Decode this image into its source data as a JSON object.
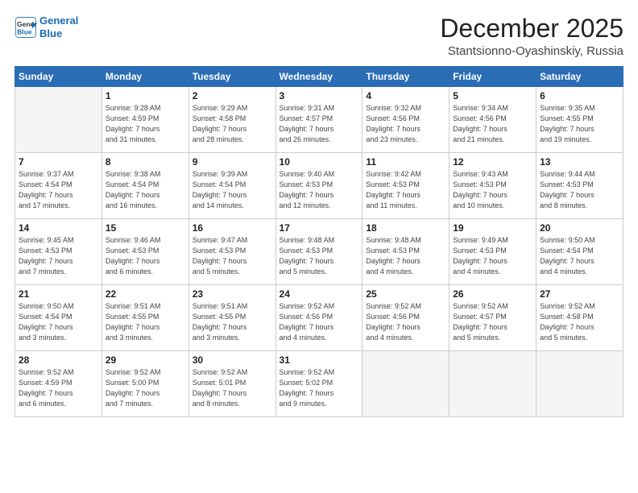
{
  "header": {
    "logo_line1": "General",
    "logo_line2": "Blue",
    "month": "December 2025",
    "location": "Stantsionno-Oyashinskiy, Russia"
  },
  "days_of_week": [
    "Sunday",
    "Monday",
    "Tuesday",
    "Wednesday",
    "Thursday",
    "Friday",
    "Saturday"
  ],
  "weeks": [
    [
      {
        "day": "",
        "info": ""
      },
      {
        "day": "1",
        "info": "Sunrise: 9:28 AM\nSunset: 4:59 PM\nDaylight: 7 hours\nand 31 minutes."
      },
      {
        "day": "2",
        "info": "Sunrise: 9:29 AM\nSunset: 4:58 PM\nDaylight: 7 hours\nand 28 minutes."
      },
      {
        "day": "3",
        "info": "Sunrise: 9:31 AM\nSunset: 4:57 PM\nDaylight: 7 hours\nand 26 minutes."
      },
      {
        "day": "4",
        "info": "Sunrise: 9:32 AM\nSunset: 4:56 PM\nDaylight: 7 hours\nand 23 minutes."
      },
      {
        "day": "5",
        "info": "Sunrise: 9:34 AM\nSunset: 4:56 PM\nDaylight: 7 hours\nand 21 minutes."
      },
      {
        "day": "6",
        "info": "Sunrise: 9:35 AM\nSunset: 4:55 PM\nDaylight: 7 hours\nand 19 minutes."
      }
    ],
    [
      {
        "day": "7",
        "info": "Sunrise: 9:37 AM\nSunset: 4:54 PM\nDaylight: 7 hours\nand 17 minutes."
      },
      {
        "day": "8",
        "info": "Sunrise: 9:38 AM\nSunset: 4:54 PM\nDaylight: 7 hours\nand 16 minutes."
      },
      {
        "day": "9",
        "info": "Sunrise: 9:39 AM\nSunset: 4:54 PM\nDaylight: 7 hours\nand 14 minutes."
      },
      {
        "day": "10",
        "info": "Sunrise: 9:40 AM\nSunset: 4:53 PM\nDaylight: 7 hours\nand 12 minutes."
      },
      {
        "day": "11",
        "info": "Sunrise: 9:42 AM\nSunset: 4:53 PM\nDaylight: 7 hours\nand 11 minutes."
      },
      {
        "day": "12",
        "info": "Sunrise: 9:43 AM\nSunset: 4:53 PM\nDaylight: 7 hours\nand 10 minutes."
      },
      {
        "day": "13",
        "info": "Sunrise: 9:44 AM\nSunset: 4:53 PM\nDaylight: 7 hours\nand 8 minutes."
      }
    ],
    [
      {
        "day": "14",
        "info": "Sunrise: 9:45 AM\nSunset: 4:53 PM\nDaylight: 7 hours\nand 7 minutes."
      },
      {
        "day": "15",
        "info": "Sunrise: 9:46 AM\nSunset: 4:53 PM\nDaylight: 7 hours\nand 6 minutes."
      },
      {
        "day": "16",
        "info": "Sunrise: 9:47 AM\nSunset: 4:53 PM\nDaylight: 7 hours\nand 5 minutes."
      },
      {
        "day": "17",
        "info": "Sunrise: 9:48 AM\nSunset: 4:53 PM\nDaylight: 7 hours\nand 5 minutes."
      },
      {
        "day": "18",
        "info": "Sunrise: 9:48 AM\nSunset: 4:53 PM\nDaylight: 7 hours\nand 4 minutes."
      },
      {
        "day": "19",
        "info": "Sunrise: 9:49 AM\nSunset: 4:53 PM\nDaylight: 7 hours\nand 4 minutes."
      },
      {
        "day": "20",
        "info": "Sunrise: 9:50 AM\nSunset: 4:54 PM\nDaylight: 7 hours\nand 4 minutes."
      }
    ],
    [
      {
        "day": "21",
        "info": "Sunrise: 9:50 AM\nSunset: 4:54 PM\nDaylight: 7 hours\nand 3 minutes."
      },
      {
        "day": "22",
        "info": "Sunrise: 9:51 AM\nSunset: 4:55 PM\nDaylight: 7 hours\nand 3 minutes."
      },
      {
        "day": "23",
        "info": "Sunrise: 9:51 AM\nSunset: 4:55 PM\nDaylight: 7 hours\nand 3 minutes."
      },
      {
        "day": "24",
        "info": "Sunrise: 9:52 AM\nSunset: 4:56 PM\nDaylight: 7 hours\nand 4 minutes."
      },
      {
        "day": "25",
        "info": "Sunrise: 9:52 AM\nSunset: 4:56 PM\nDaylight: 7 hours\nand 4 minutes."
      },
      {
        "day": "26",
        "info": "Sunrise: 9:52 AM\nSunset: 4:57 PM\nDaylight: 7 hours\nand 5 minutes."
      },
      {
        "day": "27",
        "info": "Sunrise: 9:52 AM\nSunset: 4:58 PM\nDaylight: 7 hours\nand 5 minutes."
      }
    ],
    [
      {
        "day": "28",
        "info": "Sunrise: 9:52 AM\nSunset: 4:59 PM\nDaylight: 7 hours\nand 6 minutes."
      },
      {
        "day": "29",
        "info": "Sunrise: 9:52 AM\nSunset: 5:00 PM\nDaylight: 7 hours\nand 7 minutes."
      },
      {
        "day": "30",
        "info": "Sunrise: 9:52 AM\nSunset: 5:01 PM\nDaylight: 7 hours\nand 8 minutes."
      },
      {
        "day": "31",
        "info": "Sunrise: 9:52 AM\nSunset: 5:02 PM\nDaylight: 7 hours\nand 9 minutes."
      },
      {
        "day": "",
        "info": ""
      },
      {
        "day": "",
        "info": ""
      },
      {
        "day": "",
        "info": ""
      }
    ]
  ]
}
